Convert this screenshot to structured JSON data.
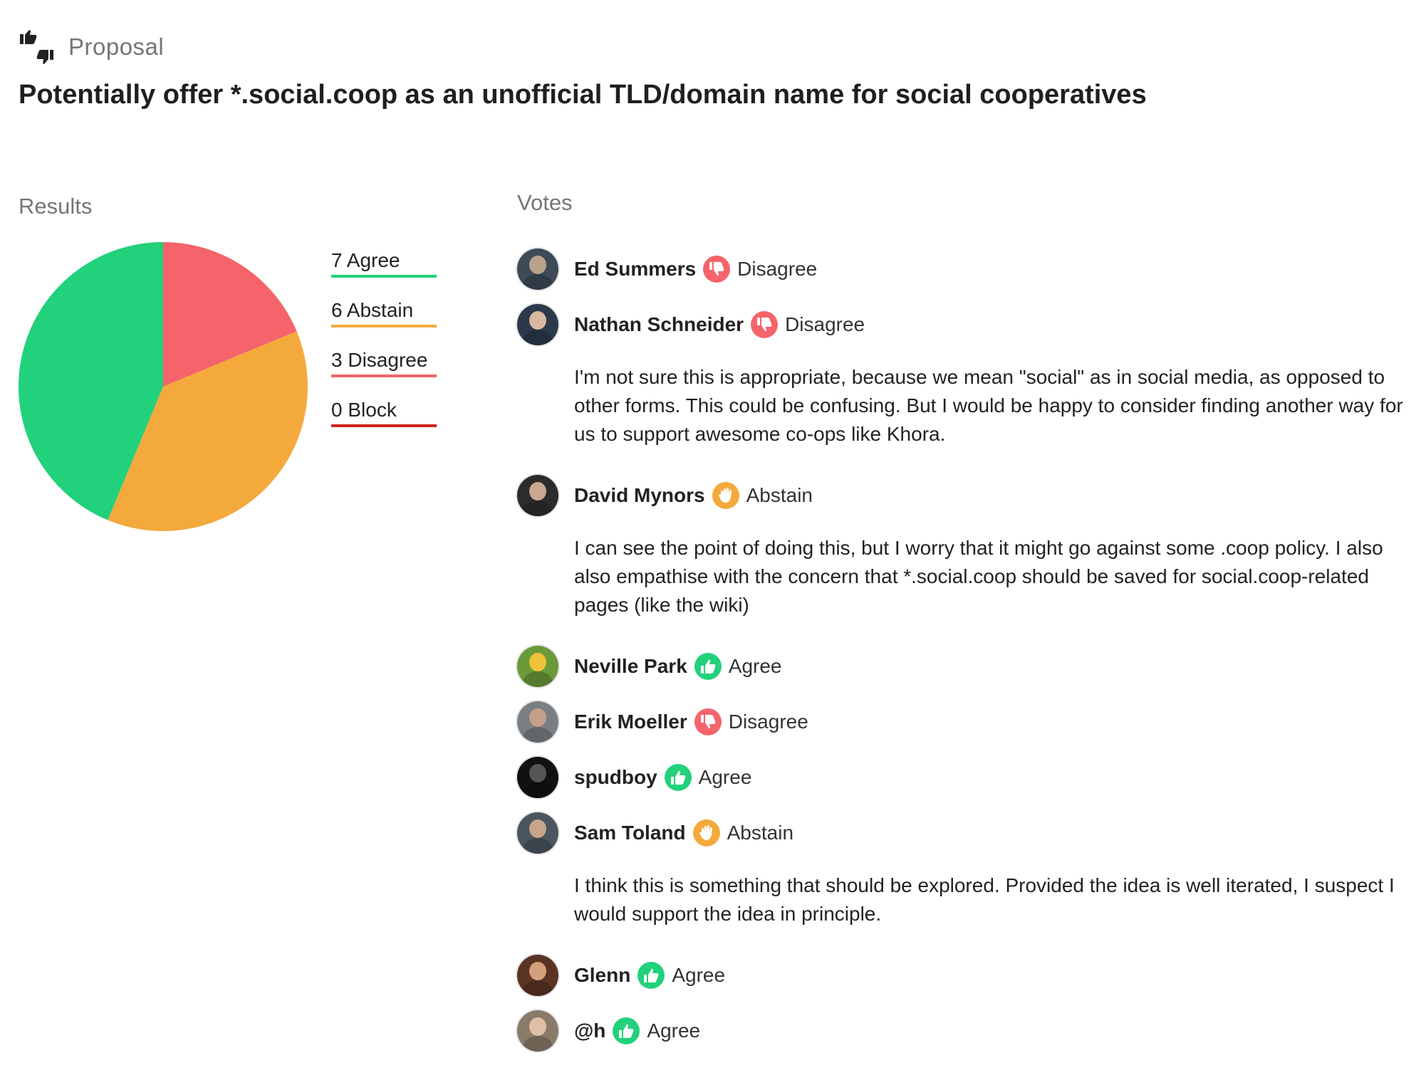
{
  "header": {
    "kind_label": "Proposal",
    "title": "Potentially offer *.social.coop as an unofficial TLD/domain name for social cooperatives"
  },
  "results": {
    "label": "Results",
    "legend": [
      {
        "count": 7,
        "label": "7 Agree",
        "color": "#22d17b"
      },
      {
        "count": 6,
        "label": "6 Abstain",
        "color": "#f4a93c"
      },
      {
        "count": 3,
        "label": "3 Disagree",
        "color": "#f5646a"
      },
      {
        "count": 0,
        "label": "0 Block",
        "color": "#d1231e"
      }
    ]
  },
  "chart_data": {
    "type": "pie",
    "categories": [
      "Disagree",
      "Abstain",
      "Agree",
      "Block"
    ],
    "values": [
      3,
      6,
      7,
      0
    ],
    "colors": [
      "#f5646a",
      "#f4a93c",
      "#22d17b",
      "#d1231e"
    ]
  },
  "votes": {
    "label": "Votes",
    "items": [
      {
        "name": "Ed Summers",
        "position": "Disagree",
        "icon": "thumbs-down-icon",
        "color": "#f5646a",
        "reason": "",
        "avatar": [
          "#3d4a57",
          "#b9a18b"
        ]
      },
      {
        "name": "Nathan Schneider",
        "position": "Disagree",
        "icon": "thumbs-down-icon",
        "color": "#f5646a",
        "reason": "I'm not sure this is appropriate, because we mean \"social\" as in social media, as opposed to other forms. This could be confusing. But I would be happy to consider finding another way for us to support awesome co-ops like Khora.",
        "avatar": [
          "#2b3a4a",
          "#d9b9a0"
        ]
      },
      {
        "name": "David Mynors",
        "position": "Abstain",
        "icon": "hand-stop-icon",
        "color": "#f4a93c",
        "reason": "I can see the point of doing this, but I worry that it might go against some .coop policy. I also also empathise with the concern that *.social.coop should be saved for social.coop-related pages (like the wiki)",
        "avatar": [
          "#2c2c2c",
          "#c8a890"
        ]
      },
      {
        "name": "Neville Park",
        "position": "Agree",
        "icon": "thumbs-up-icon",
        "color": "#22d17b",
        "reason": "",
        "avatar": [
          "#6a9a3a",
          "#f0c23a"
        ]
      },
      {
        "name": "Erik Moeller",
        "position": "Disagree",
        "icon": "thumbs-down-icon",
        "color": "#f5646a",
        "reason": "",
        "avatar": [
          "#7a7f84",
          "#c4a089"
        ]
      },
      {
        "name": "spudboy",
        "position": "Agree",
        "icon": "thumbs-up-icon",
        "color": "#22d17b",
        "reason": "",
        "avatar": [
          "#111111",
          "#555555"
        ]
      },
      {
        "name": "Sam Toland",
        "position": "Abstain",
        "icon": "hand-stop-icon",
        "color": "#f4a93c",
        "reason": "I think this is something that should be explored. Provided the idea is well iterated, I suspect I would support the idea in principle.",
        "avatar": [
          "#4a5560",
          "#c8a48a"
        ]
      },
      {
        "name": "Glenn",
        "position": "Agree",
        "icon": "thumbs-up-icon",
        "color": "#22d17b",
        "reason": "",
        "avatar": [
          "#5a3322",
          "#d4a07c"
        ]
      },
      {
        "name": "@h",
        "position": "Agree",
        "icon": "thumbs-up-icon",
        "color": "#22d17b",
        "reason": "",
        "avatar": [
          "#8a7a6a",
          "#e0c0a4"
        ]
      }
    ]
  }
}
